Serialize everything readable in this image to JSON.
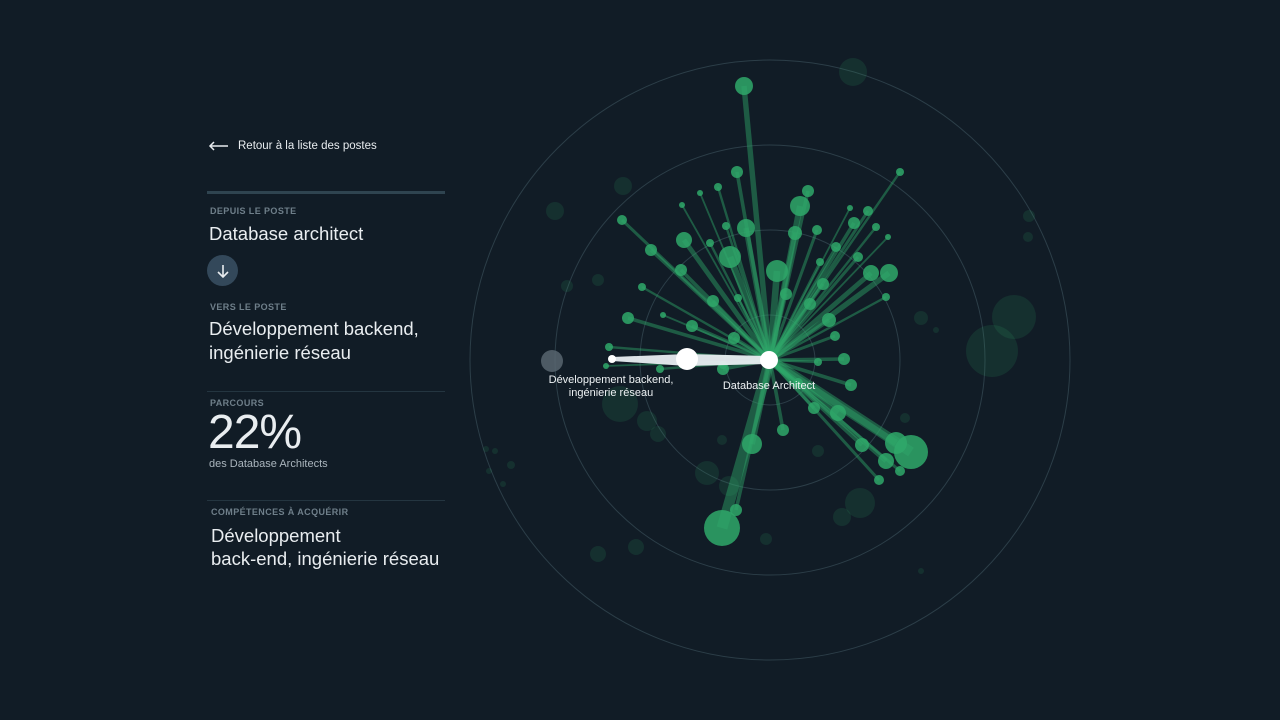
{
  "nav": {
    "back_label": "Retour à la liste des postes"
  },
  "from": {
    "label": "DEPUIS LE POSTE",
    "value": "Database architect"
  },
  "to": {
    "label": "VERS LE POSTE",
    "value_line1": "Développement backend,",
    "value_line2": "ingénierie réseau"
  },
  "pathway": {
    "label": "PARCOURS",
    "percent": "22%",
    "caption": "des Database Architects"
  },
  "skills": {
    "label": "COMPÉTENCES À ACQUÉRIR",
    "value_line1": "Développement",
    "value_line2": "back-end, ingénierie réseau"
  },
  "graph": {
    "source_label": "Database Architect",
    "target_label_line1": "Développement backend,",
    "target_label_line2": "ingénierie réseau",
    "colors": {
      "node": "#2fa86a",
      "ring": "#2c3e48",
      "highlight": "#ffffff",
      "background": "#111c26"
    }
  }
}
